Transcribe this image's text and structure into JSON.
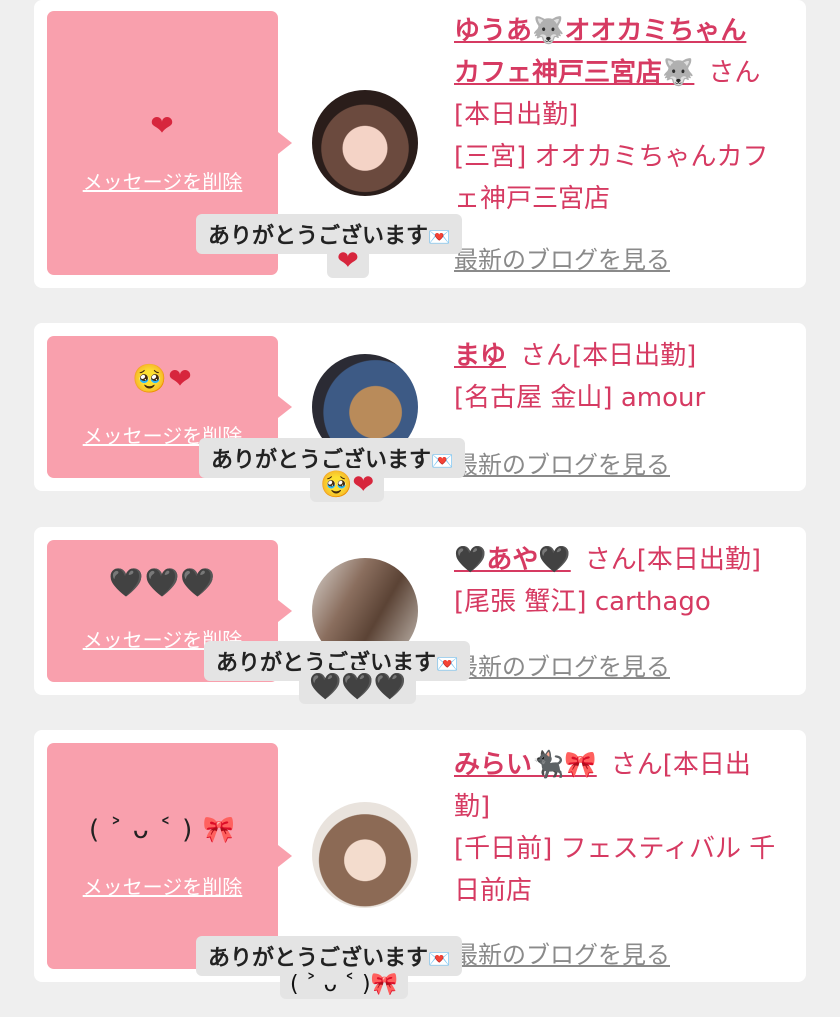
{
  "delete_label": "メッセージを削除",
  "toast_label": "ありがとうございます",
  "envelope_icon": "💌",
  "blog_label": "最新のブログを見る",
  "cards": [
    {
      "message": "❤",
      "name_line1": "ゆうあ🐺オオカミちゃん",
      "name_line2": "カフェ神戸三宮店🐺",
      "san": "さん",
      "status": "[本日出勤]",
      "shop_line1": "[三宮] オオカミちゃんカフ",
      "shop_line2": "ェ神戸三宮店",
      "reaction": "❤"
    },
    {
      "message": "🥹❤",
      "name": "まゆ",
      "san_status": "さん[本日出勤]",
      "shop": "[名古屋 金山] amour",
      "reaction": "🥹❤"
    },
    {
      "message": "🖤🖤🖤",
      "name": "🖤あや🖤",
      "san_status": "さん[本日出勤]",
      "shop": "[尾張 蟹江] carthago",
      "reaction": "🖤🖤🖤"
    },
    {
      "message": "( ˃ ᴗ ˂ ) 🎀",
      "name": "みらい🐈‍⬛🎀",
      "san_status_line1": "さん[本日出",
      "san_status_line2": "勤]",
      "shop_line1": "[千日前] フェスティバル 千",
      "shop_line2": "日前店",
      "reaction": "( ˃ ᴗ ˂ )🎀"
    }
  ]
}
